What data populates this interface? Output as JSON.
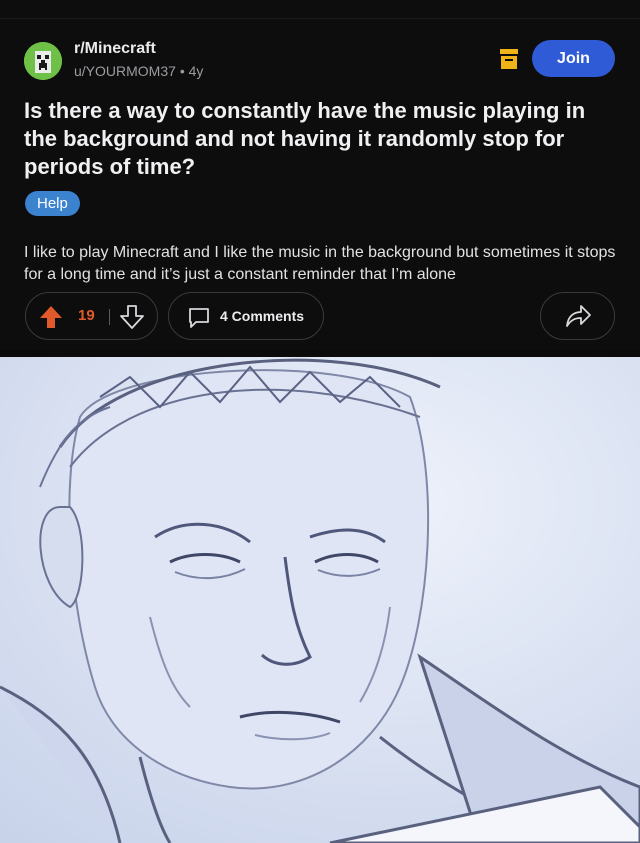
{
  "post": {
    "subreddit": "r/Minecraft",
    "author": "u/YOURMOM37",
    "age": "4y",
    "join_label": "Join",
    "title": "Is there a way to constantly have the music playing in the background and not having it randomly stop for periods of time?",
    "flair": "Help",
    "body": "I like to play Minecraft and I like the music in the background but sometimes it stops for a long time and it’s just a constant reminder that I’m alone",
    "score": "19",
    "comments_label": "4 Comments"
  },
  "colors": {
    "background": "#0d0d0e",
    "join_button": "#2f5bd6",
    "flair": "#3b82cf",
    "upvote_active": "#e05a2b",
    "archive_icon": "#f0b419",
    "avatar": "#6fc046"
  },
  "icons": [
    "creeper-avatar-icon",
    "archive-icon",
    "upvote-icon",
    "downvote-icon",
    "comment-icon",
    "share-icon"
  ]
}
